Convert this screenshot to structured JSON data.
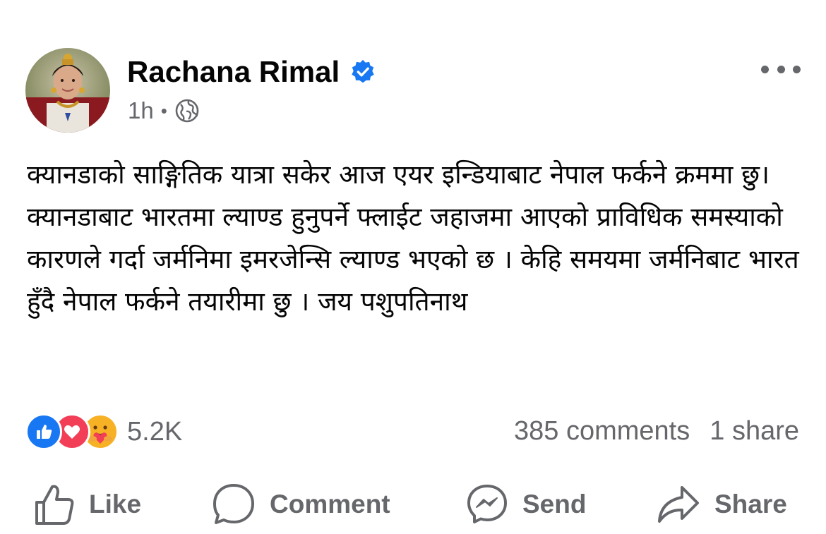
{
  "post": {
    "author": "Rachana Rimal",
    "verified": true,
    "time": "1h",
    "audience_icon": "globe-icon",
    "text": "क्यानडाको साङ्गितिक यात्रा सकेर आज एयर इन्डियाबाट नेपाल फर्कने क्रममा छु। क्यानडाबाट भारतमा ल्याण्ड हुनुपर्ने फ्लाईट जहाजमा आएको प्राविधिक समस्याको कारणले गर्दा जर्मनिमा इमरजेन्सि ल्याण्ड भएको छ । केहि समयमा जर्मनिबाट भारत हुँदै नेपाल फर्कने तयारीमा छु । जय पशुपतिनाथ"
  },
  "stats": {
    "reaction_icons": [
      "like-reaction-icon",
      "love-reaction-icon",
      "care-reaction-icon"
    ],
    "reactions": "5.2K",
    "comments": "385 comments",
    "shares": "1 share"
  },
  "actions": {
    "like": "Like",
    "comment": "Comment",
    "send": "Send",
    "share": "Share"
  },
  "colors": {
    "verified_blue": "#1877f2",
    "secondary_text": "#65676b",
    "love_red": "#f33e58",
    "care_yellow": "#f7b125"
  }
}
